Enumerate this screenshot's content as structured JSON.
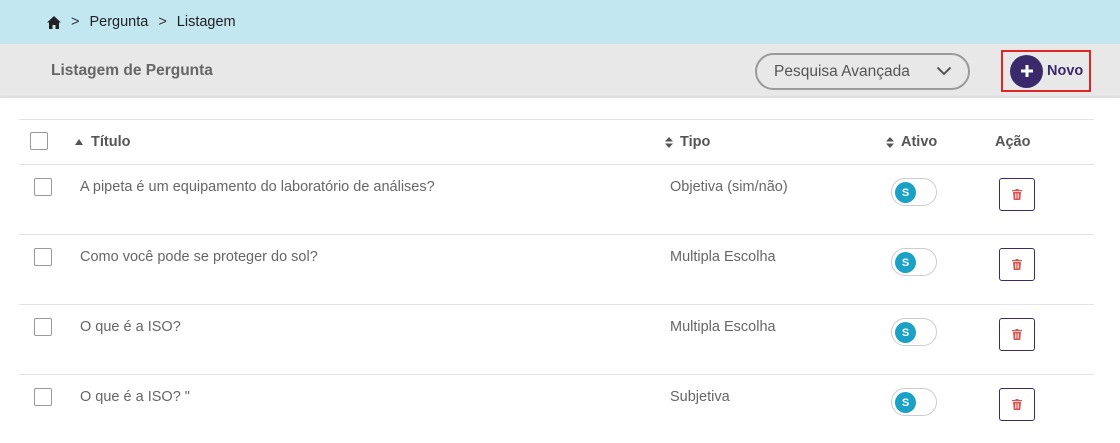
{
  "breadcrumb": {
    "separator": ">",
    "items": [
      "Pergunta",
      "Listagem"
    ]
  },
  "header": {
    "title": "Listagem de Pergunta",
    "advanced_search_label": "Pesquisa Avançada",
    "new_button_label": "Novo"
  },
  "table": {
    "columns": {
      "titulo": "Título",
      "tipo": "Tipo",
      "ativo": "Ativo",
      "acao": "Ação"
    },
    "rows": [
      {
        "titulo": "A pipeta é um equipamento do laboratório de análises?",
        "tipo": "Objetiva (sim/não)",
        "ativo": "S"
      },
      {
        "titulo": "Como você pode se proteger do sol?",
        "tipo": "Multipla Escolha",
        "ativo": "S"
      },
      {
        "titulo": "O que é a ISO?",
        "tipo": "Multipla Escolha",
        "ativo": "S"
      },
      {
        "titulo": "O que é a ISO? \"",
        "tipo": "Subjetiva",
        "ativo": "S"
      }
    ]
  },
  "icons": {
    "home": "home-icon",
    "chevron": "chevron-down-icon",
    "plus": "plus-icon",
    "sort": "sort-icon",
    "trash": "trash-icon"
  },
  "colors": {
    "breadcrumb_bg": "#c3e7f1",
    "header_bg": "#e8e8e8",
    "primary": "#3a2a6b",
    "toggle_on": "#1ba0c6",
    "highlight_border": "#e02525",
    "trash": "#d9534f"
  }
}
